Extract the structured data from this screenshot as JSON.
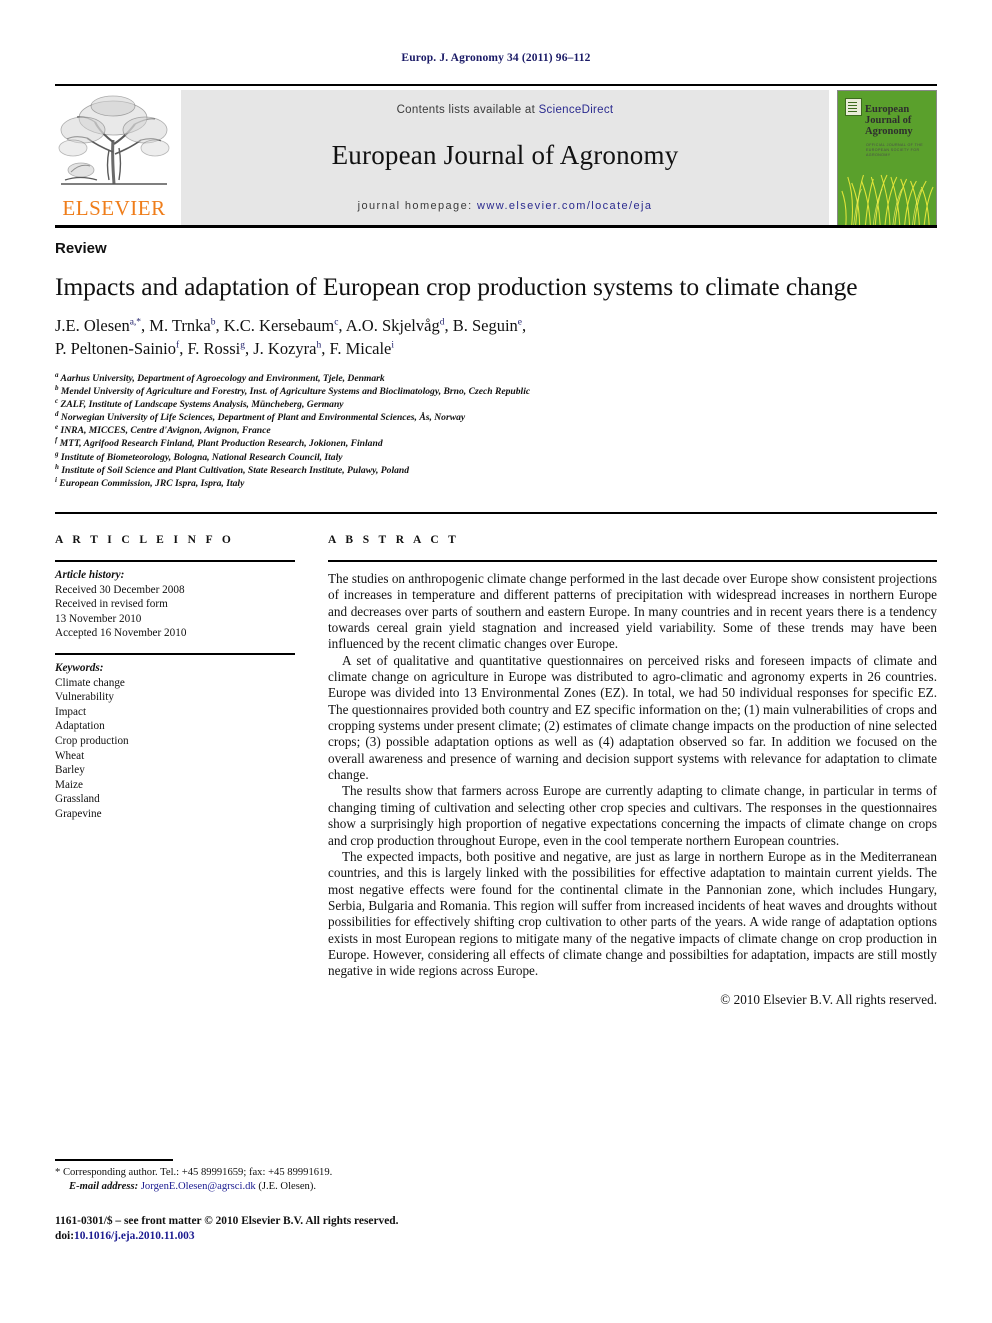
{
  "running_head": "Europ. J. Agronomy 34 (2011) 96–112",
  "masthead": {
    "contents_prefix": "Contents lists available at ",
    "sciencedirect": "ScienceDirect",
    "journal_title": "European Journal of Agronomy",
    "homepage_prefix": "journal homepage:",
    "homepage_url": "www.elsevier.com/locate/eja",
    "publisher_wordmark": "ELSEVIER",
    "cover": {
      "title": "European Journal of Agronomy",
      "subtitle": "OFFICIAL JOURNAL OF THE EUROPEAN SOCIETY FOR AGRONOMY",
      "bg_color": "#5aa02c"
    }
  },
  "article": {
    "doc_type": "Review",
    "title": "Impacts and adaptation of European crop production systems to climate change",
    "authors_line1": "J.E. Olesen",
    "authors": [
      {
        "name": "J.E. Olesen",
        "sup": "a,*"
      },
      {
        "name": "M. Trnka",
        "sup": "b"
      },
      {
        "name": "K.C. Kersebaum",
        "sup": "c"
      },
      {
        "name": "A.O. Skjelvåg",
        "sup": "d"
      },
      {
        "name": "B. Seguin",
        "sup": "e"
      },
      {
        "name": "P. Peltonen-Sainio",
        "sup": "f"
      },
      {
        "name": "F. Rossi",
        "sup": "g"
      },
      {
        "name": "J. Kozyra",
        "sup": "h"
      },
      {
        "name": "F. Micale",
        "sup": "i"
      }
    ],
    "affiliations": [
      {
        "sup": "a",
        "text": "Aarhus University, Department of Agroecology and Environment, Tjele, Denmark"
      },
      {
        "sup": "b",
        "text": "Mendel University of Agriculture and Forestry, Inst. of Agriculture Systems and Bioclimatology, Brno, Czech Republic"
      },
      {
        "sup": "c",
        "text": "ZALF, Institute of Landscape Systems Analysis, Müncheberg, Germany"
      },
      {
        "sup": "d",
        "text": "Norwegian University of Life Sciences, Department of Plant and Environmental Sciences, Ås, Norway"
      },
      {
        "sup": "e",
        "text": "INRA, MICCES, Centre d'Avignon, Avignon, France"
      },
      {
        "sup": "f",
        "text": "MTT, Agrifood Research Finland, Plant Production Research, Jokionen, Finland"
      },
      {
        "sup": "g",
        "text": "Institute of Biometeorology, Bologna, National Research Council, Italy"
      },
      {
        "sup": "h",
        "text": "Institute of Soil Science and Plant Cultivation, State Research Institute, Pulawy, Poland"
      },
      {
        "sup": "i",
        "text": "European Commission, JRC Ispra, Ispra, Italy"
      }
    ]
  },
  "article_info": {
    "heading": "A R T I C L E    I N F O",
    "history_label": "Article history:",
    "history": [
      "Received 30 December 2008",
      "Received in revised form",
      "13 November 2010",
      "Accepted 16 November 2010"
    ],
    "keywords_label": "Keywords:",
    "keywords": [
      "Climate change",
      "Vulnerability",
      "Impact",
      "Adaptation",
      "Crop production",
      "Wheat",
      "Barley",
      "Maize",
      "Grassland",
      "Grapevine"
    ]
  },
  "abstract": {
    "heading": "A B S T R A C T",
    "paragraphs": [
      "The studies on anthropogenic climate change performed in the last decade over Europe show consistent projections of increases in temperature and different patterns of precipitation with widespread increases in northern Europe and decreases over parts of southern and eastern Europe. In many countries and in recent years there is a tendency towards cereal grain yield stagnation and increased yield variability. Some of these trends may have been influenced by the recent climatic changes over Europe.",
      "A set of qualitative and quantitative questionnaires on perceived risks and foreseen impacts of climate and climate change on agriculture in Europe was distributed to agro-climatic and agronomy experts in 26 countries. Europe was divided into 13 Environmental Zones (EZ). In total, we had 50 individual responses for specific EZ. The questionnaires provided both country and EZ specific information on the; (1) main vulnerabilities of crops and cropping systems under present climate; (2) estimates of climate change impacts on the production of nine selected crops; (3) possible adaptation options as well as (4) adaptation observed so far. In addition we focused on the overall awareness and presence of warning and decision support systems with relevance for adaptation to climate change.",
      "The results show that farmers across Europe are currently adapting to climate change, in particular in terms of changing timing of cultivation and selecting other crop species and cultivars. The responses in the questionnaires show a surprisingly high proportion of negative expectations concerning the impacts of climate change on crops and crop production throughout Europe, even in the cool temperate northern European countries.",
      "The expected impacts, both positive and negative, are just as large in northern Europe as in the Mediterranean countries, and this is largely linked with the possibilities for effective adaptation to maintain current yields. The most negative effects were found for the continental climate in the Pannonian zone, which includes Hungary, Serbia, Bulgaria and Romania. This region will suffer from increased incidents of heat waves and droughts without possibilities for effectively shifting crop cultivation to other parts of the years. A wide range of adaptation options exists in most European regions to mitigate many of the negative impacts of climate change on crop production in Europe. However, considering all effects of climate change and possibilties for adaptation, impacts are still mostly negative in wide regions across Europe."
    ],
    "copyright": "© 2010 Elsevier B.V. All rights reserved."
  },
  "footer": {
    "corresponding": "* Corresponding author. Tel.: +45 89991659; fax: +45 89991619.",
    "email_label": "E-mail address:",
    "email": "JorgenE.Olesen@agrsci.dk",
    "email_owner": "(J.E. Olesen).",
    "imprint": "1161-0301/$ – see front matter © 2010 Elsevier B.V. All rights reserved.",
    "doi_label": "doi:",
    "doi_value": "10.1016/j.eja.2010.11.003"
  }
}
